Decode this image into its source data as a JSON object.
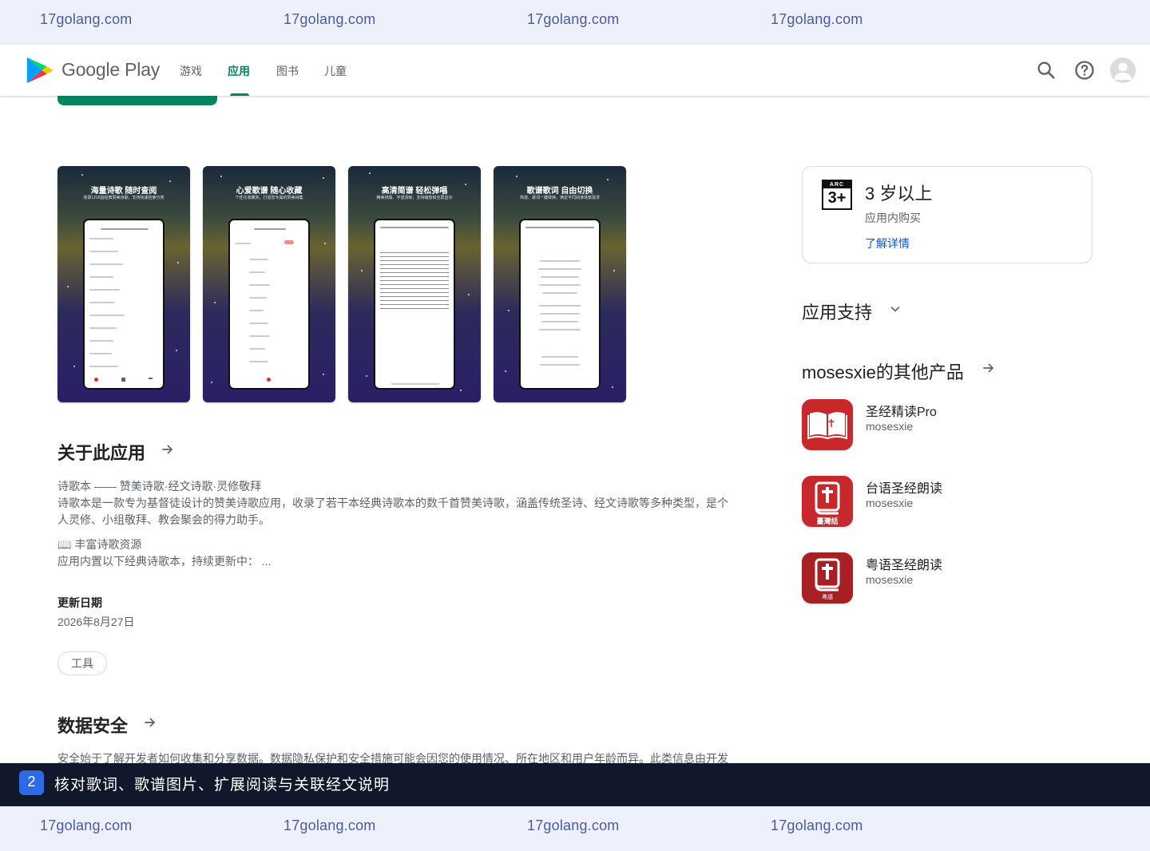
{
  "watermarks": [
    "17golang.com",
    "17golang.com",
    "17golang.com",
    "17golang.com"
  ],
  "header": {
    "brand": "Google Play",
    "nav": [
      {
        "label": "游戏"
      },
      {
        "label": "应用"
      },
      {
        "label": "图书"
      },
      {
        "label": "儿童"
      }
    ],
    "active_tab": "应用",
    "icons": [
      "search-icon",
      "help-icon",
      "account-icon"
    ]
  },
  "screenshots": [
    {
      "caption": "海量诗歌 随时查阅",
      "subtitle": "收录1218首经典赞美诗歌，支持快速检索分类"
    },
    {
      "caption": "心爱歌谱 随心收藏",
      "subtitle": "个性化收藏夹，打造您专属的赞美诗集"
    },
    {
      "caption": "高清简谱 轻松弹唱",
      "subtitle": "精美排版、字迹清晰，支持缩放和全屏显示"
    },
    {
      "caption": "歌谱歌词 自由切换",
      "subtitle": "简谱、歌词一键转换，满足不同阅读场景需求"
    }
  ],
  "about": {
    "title": "关于此应用",
    "line1": "诗歌本 —— 赞美诗歌·经文诗歌·灵修敬拜",
    "line2": "诗歌本是一款专为基督徒设计的赞美诗歌应用，收录了若干本经典诗歌本的数千首赞美诗歌，涵盖传统圣诗、经文诗歌等多种类型，是个",
    "line3": "人灵修、小组敬拜、教会聚会的得力助手。",
    "line4": "📖 丰富诗歌资源",
    "line5": "应用内置以下经典诗歌本，持续更新中：  ..."
  },
  "update": {
    "label": "更新日期",
    "date": "2026年8月27日"
  },
  "category_chip": "工具",
  "data_safety": {
    "title": "数据安全",
    "text": "安全始于了解开发者如何收集和分享数据。数据隐私保护和安全措施可能会因您的使用情况、所在地区和用户年龄而异。此类信息由开发"
  },
  "rating": {
    "badge_top": "ARC",
    "badge_main": "3+",
    "label": "3 岁以上",
    "iap": "应用内购买",
    "learn_more": "了解详情"
  },
  "support": {
    "title": "应用支持"
  },
  "other_apps": {
    "title": "mosesxie的其他产品",
    "apps": [
      {
        "name": "圣经精读Pro",
        "developer": "mosesxie"
      },
      {
        "name": "台语圣经朗读",
        "developer": "mosesxie",
        "icon_text": "臺灣話"
      },
      {
        "name": "粤语圣经朗读",
        "developer": "mosesxie",
        "icon_text": "粵語"
      }
    ]
  },
  "caption": {
    "number": "2",
    "text": "核对歌词、歌谱图片、扩展阅读与关联经文说明"
  },
  "colors": {
    "accent": "#01875f",
    "link": "#0b57d0",
    "caption_bg": "#11182b",
    "watermark_bg": "#eef1fc",
    "app_icon_red": "#c8282b"
  }
}
